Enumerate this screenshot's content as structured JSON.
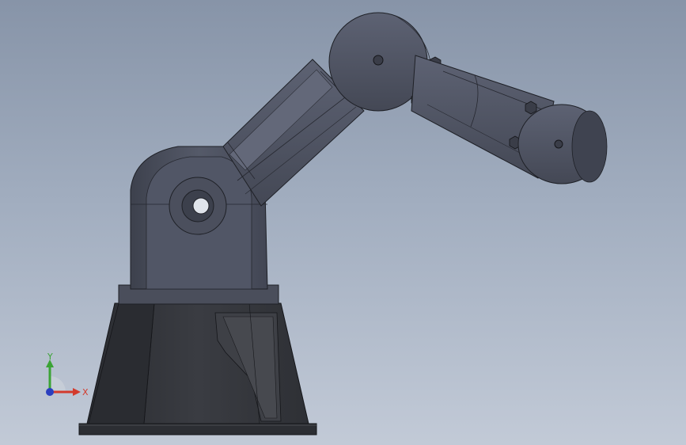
{
  "viewport": {
    "background_top": "#8794a8",
    "background_bottom": "#c2cad7"
  },
  "model": {
    "body_color": "#4f5463",
    "body_dark": "#3b3f4b",
    "base_color": "#34363c",
    "edge_color": "#1e2026"
  },
  "triad": {
    "x_label": "X",
    "y_label": "Y",
    "x_color": "#d33a2c",
    "y_color": "#3ba335",
    "z_color": "#2b3fbf"
  }
}
